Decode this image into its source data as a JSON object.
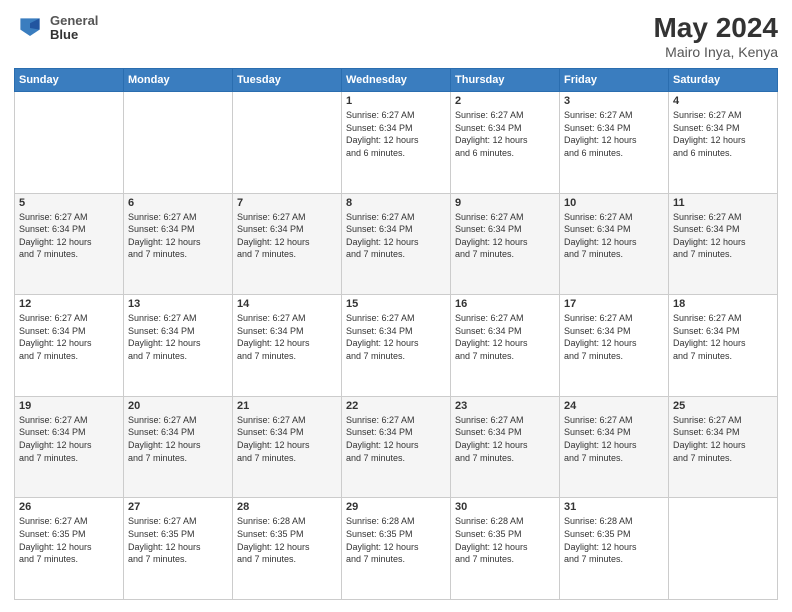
{
  "header": {
    "logo_line1": "General",
    "logo_line2": "Blue",
    "month_year": "May 2024",
    "location": "Mairo Inya, Kenya"
  },
  "days_of_week": [
    "Sunday",
    "Monday",
    "Tuesday",
    "Wednesday",
    "Thursday",
    "Friday",
    "Saturday"
  ],
  "weeks": [
    {
      "row_class": "",
      "days": [
        {
          "num": "",
          "info": ""
        },
        {
          "num": "",
          "info": ""
        },
        {
          "num": "",
          "info": ""
        },
        {
          "num": "1",
          "info": "Sunrise: 6:27 AM\nSunset: 6:34 PM\nDaylight: 12 hours\nand 6 minutes."
        },
        {
          "num": "2",
          "info": "Sunrise: 6:27 AM\nSunset: 6:34 PM\nDaylight: 12 hours\nand 6 minutes."
        },
        {
          "num": "3",
          "info": "Sunrise: 6:27 AM\nSunset: 6:34 PM\nDaylight: 12 hours\nand 6 minutes."
        },
        {
          "num": "4",
          "info": "Sunrise: 6:27 AM\nSunset: 6:34 PM\nDaylight: 12 hours\nand 6 minutes."
        }
      ]
    },
    {
      "row_class": "alt-row",
      "days": [
        {
          "num": "5",
          "info": "Sunrise: 6:27 AM\nSunset: 6:34 PM\nDaylight: 12 hours\nand 7 minutes."
        },
        {
          "num": "6",
          "info": "Sunrise: 6:27 AM\nSunset: 6:34 PM\nDaylight: 12 hours\nand 7 minutes."
        },
        {
          "num": "7",
          "info": "Sunrise: 6:27 AM\nSunset: 6:34 PM\nDaylight: 12 hours\nand 7 minutes."
        },
        {
          "num": "8",
          "info": "Sunrise: 6:27 AM\nSunset: 6:34 PM\nDaylight: 12 hours\nand 7 minutes."
        },
        {
          "num": "9",
          "info": "Sunrise: 6:27 AM\nSunset: 6:34 PM\nDaylight: 12 hours\nand 7 minutes."
        },
        {
          "num": "10",
          "info": "Sunrise: 6:27 AM\nSunset: 6:34 PM\nDaylight: 12 hours\nand 7 minutes."
        },
        {
          "num": "11",
          "info": "Sunrise: 6:27 AM\nSunset: 6:34 PM\nDaylight: 12 hours\nand 7 minutes."
        }
      ]
    },
    {
      "row_class": "",
      "days": [
        {
          "num": "12",
          "info": "Sunrise: 6:27 AM\nSunset: 6:34 PM\nDaylight: 12 hours\nand 7 minutes."
        },
        {
          "num": "13",
          "info": "Sunrise: 6:27 AM\nSunset: 6:34 PM\nDaylight: 12 hours\nand 7 minutes."
        },
        {
          "num": "14",
          "info": "Sunrise: 6:27 AM\nSunset: 6:34 PM\nDaylight: 12 hours\nand 7 minutes."
        },
        {
          "num": "15",
          "info": "Sunrise: 6:27 AM\nSunset: 6:34 PM\nDaylight: 12 hours\nand 7 minutes."
        },
        {
          "num": "16",
          "info": "Sunrise: 6:27 AM\nSunset: 6:34 PM\nDaylight: 12 hours\nand 7 minutes."
        },
        {
          "num": "17",
          "info": "Sunrise: 6:27 AM\nSunset: 6:34 PM\nDaylight: 12 hours\nand 7 minutes."
        },
        {
          "num": "18",
          "info": "Sunrise: 6:27 AM\nSunset: 6:34 PM\nDaylight: 12 hours\nand 7 minutes."
        }
      ]
    },
    {
      "row_class": "alt-row",
      "days": [
        {
          "num": "19",
          "info": "Sunrise: 6:27 AM\nSunset: 6:34 PM\nDaylight: 12 hours\nand 7 minutes."
        },
        {
          "num": "20",
          "info": "Sunrise: 6:27 AM\nSunset: 6:34 PM\nDaylight: 12 hours\nand 7 minutes."
        },
        {
          "num": "21",
          "info": "Sunrise: 6:27 AM\nSunset: 6:34 PM\nDaylight: 12 hours\nand 7 minutes."
        },
        {
          "num": "22",
          "info": "Sunrise: 6:27 AM\nSunset: 6:34 PM\nDaylight: 12 hours\nand 7 minutes."
        },
        {
          "num": "23",
          "info": "Sunrise: 6:27 AM\nSunset: 6:34 PM\nDaylight: 12 hours\nand 7 minutes."
        },
        {
          "num": "24",
          "info": "Sunrise: 6:27 AM\nSunset: 6:34 PM\nDaylight: 12 hours\nand 7 minutes."
        },
        {
          "num": "25",
          "info": "Sunrise: 6:27 AM\nSunset: 6:34 PM\nDaylight: 12 hours\nand 7 minutes."
        }
      ]
    },
    {
      "row_class": "",
      "days": [
        {
          "num": "26",
          "info": "Sunrise: 6:27 AM\nSunset: 6:35 PM\nDaylight: 12 hours\nand 7 minutes."
        },
        {
          "num": "27",
          "info": "Sunrise: 6:27 AM\nSunset: 6:35 PM\nDaylight: 12 hours\nand 7 minutes."
        },
        {
          "num": "28",
          "info": "Sunrise: 6:28 AM\nSunset: 6:35 PM\nDaylight: 12 hours\nand 7 minutes."
        },
        {
          "num": "29",
          "info": "Sunrise: 6:28 AM\nSunset: 6:35 PM\nDaylight: 12 hours\nand 7 minutes."
        },
        {
          "num": "30",
          "info": "Sunrise: 6:28 AM\nSunset: 6:35 PM\nDaylight: 12 hours\nand 7 minutes."
        },
        {
          "num": "31",
          "info": "Sunrise: 6:28 AM\nSunset: 6:35 PM\nDaylight: 12 hours\nand 7 minutes."
        },
        {
          "num": "",
          "info": ""
        }
      ]
    }
  ]
}
